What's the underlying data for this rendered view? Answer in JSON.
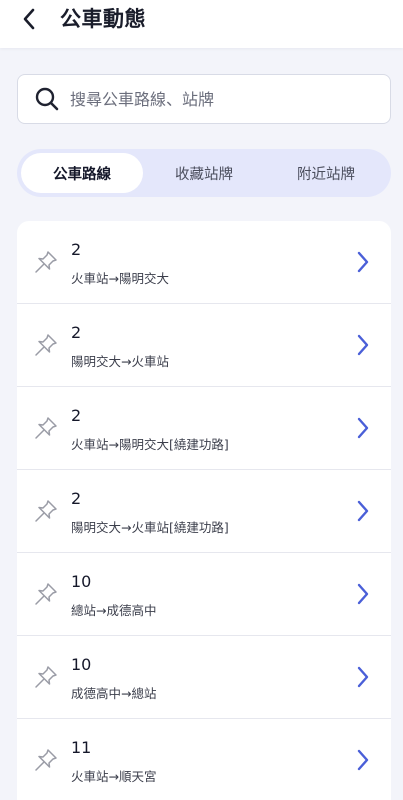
{
  "header": {
    "title": "公車動態",
    "back_icon": "chevron-left-icon"
  },
  "search": {
    "placeholder": "搜尋公車路線、站牌",
    "icon": "search-icon"
  },
  "tabs": [
    {
      "label": "公車路線",
      "active": true
    },
    {
      "label": "收藏站牌",
      "active": false
    },
    {
      "label": "附近站牌",
      "active": false
    }
  ],
  "routes": [
    {
      "number": "2",
      "direction": "火車站→陽明交大"
    },
    {
      "number": "2",
      "direction": "陽明交大→火車站"
    },
    {
      "number": "2",
      "direction": "火車站→陽明交大[繞建功路]"
    },
    {
      "number": "2",
      "direction": "陽明交大→火車站[繞建功路]"
    },
    {
      "number": "10",
      "direction": "總站→成德高中"
    },
    {
      "number": "10",
      "direction": "成德高中→總站"
    },
    {
      "number": "11",
      "direction": "火車站→順天宮"
    }
  ],
  "colors": {
    "accent": "#4a5fd8",
    "tab_track": "#e4e7fb",
    "background": "#f3f4fa"
  }
}
